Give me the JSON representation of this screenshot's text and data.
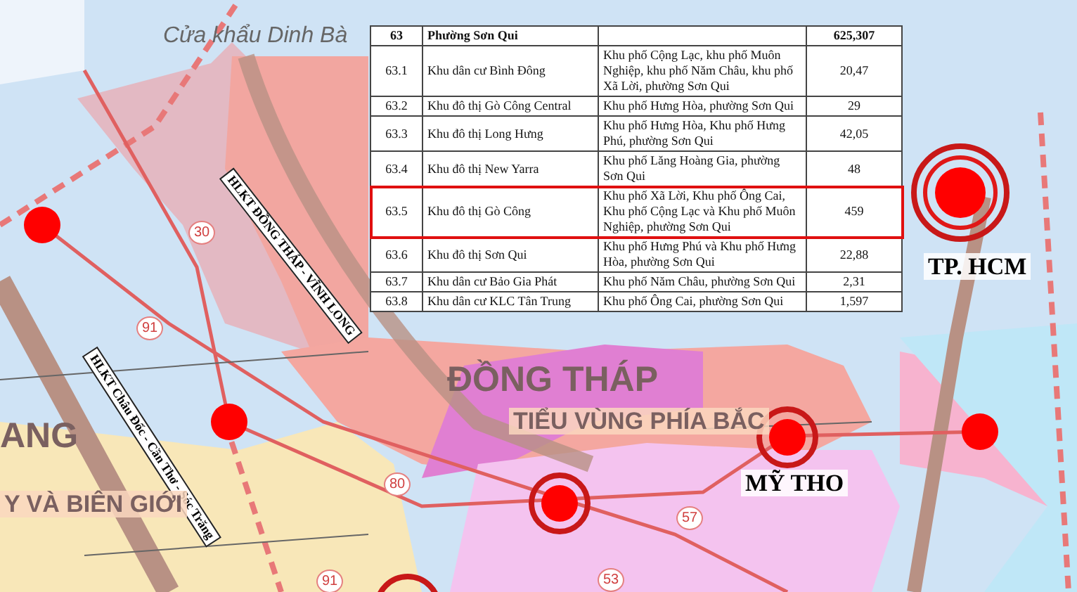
{
  "map": {
    "labels": [
      {
        "kind": "place",
        "text": "Cửa khẩu Dinh Bà"
      },
      {
        "kind": "corridor",
        "text": "HLKT ĐỒNG THÁP - VĨNH LONG"
      },
      {
        "kind": "corridor",
        "text": "HLKT Châu Đốc - Cần Thơ - Sóc Trăng"
      },
      {
        "kind": "province",
        "text": "ĐỒNG THÁP"
      },
      {
        "kind": "subregion",
        "text": "TIỂU VÙNG PHÍA BẮC"
      },
      {
        "kind": "city",
        "text": "MỸ THO"
      },
      {
        "kind": "city",
        "text": "TP. HCM"
      },
      {
        "kind": "province",
        "text": "ANG"
      },
      {
        "kind": "subregion",
        "text": "Y VÀ BIÊN GIỚI"
      },
      {
        "kind": "road",
        "text": "30"
      },
      {
        "kind": "road",
        "text": "91"
      },
      {
        "kind": "road",
        "text": "80"
      },
      {
        "kind": "road",
        "text": "57"
      },
      {
        "kind": "road",
        "text": "53"
      },
      {
        "kind": "road",
        "text": "91"
      }
    ]
  },
  "table": {
    "group": {
      "number": "63",
      "name": "Phường Sơn Qui",
      "area": "625,307"
    },
    "rows": [
      {
        "number": "63.1",
        "name": "Khu dân cư Bình Đông",
        "location": "Khu phố Cộng Lạc, khu phố Muôn Nghiệp, khu phố Năm Châu, khu phố Xã Lời, phường Sơn Qui",
        "area": "20,47",
        "selected": false
      },
      {
        "number": "63.2",
        "name": "Khu đô thị Gò Công Central",
        "location": "Khu phố Hưng Hòa, phường Sơn Qui",
        "area": "29",
        "selected": false
      },
      {
        "number": "63.3",
        "name": "Khu đô thị Long Hưng",
        "location": "Khu phố Hưng Hòa, Khu phố Hưng Phú, phường Sơn Qui",
        "area": "42,05",
        "selected": false
      },
      {
        "number": "63.4",
        "name": "Khu đô thị New Yarra",
        "location": "Khu phố Lăng Hoàng Gia, phường Sơn Qui",
        "area": "48",
        "selected": false
      },
      {
        "number": "63.5",
        "name": "Khu đô thị Gò Công",
        "location": "Khu phố Xã Lời, Khu phố Ông Cai, Khu phố Cộng Lạc và Khu phố Muôn Nghiệp, phường Sơn Qui",
        "area": "459",
        "selected": true
      },
      {
        "number": "63.6",
        "name": "Khu đô thị Sơn Qui",
        "location": "Khu phố Hưng Phú và Khu phố Hưng Hòa, phường Sơn Qui",
        "area": "22,88",
        "selected": false
      },
      {
        "number": "63.7",
        "name": "Khu dân cư Bảo Gia Phát",
        "location": "Khu phố Năm Châu, phường Sơn Qui",
        "area": "2,31",
        "selected": false
      },
      {
        "number": "63.8",
        "name": "Khu dân cư KLC Tân Trung",
        "location": "Khu phố Ông Cai, phường Sơn Qui",
        "area": "1,597",
        "selected": false
      }
    ]
  }
}
